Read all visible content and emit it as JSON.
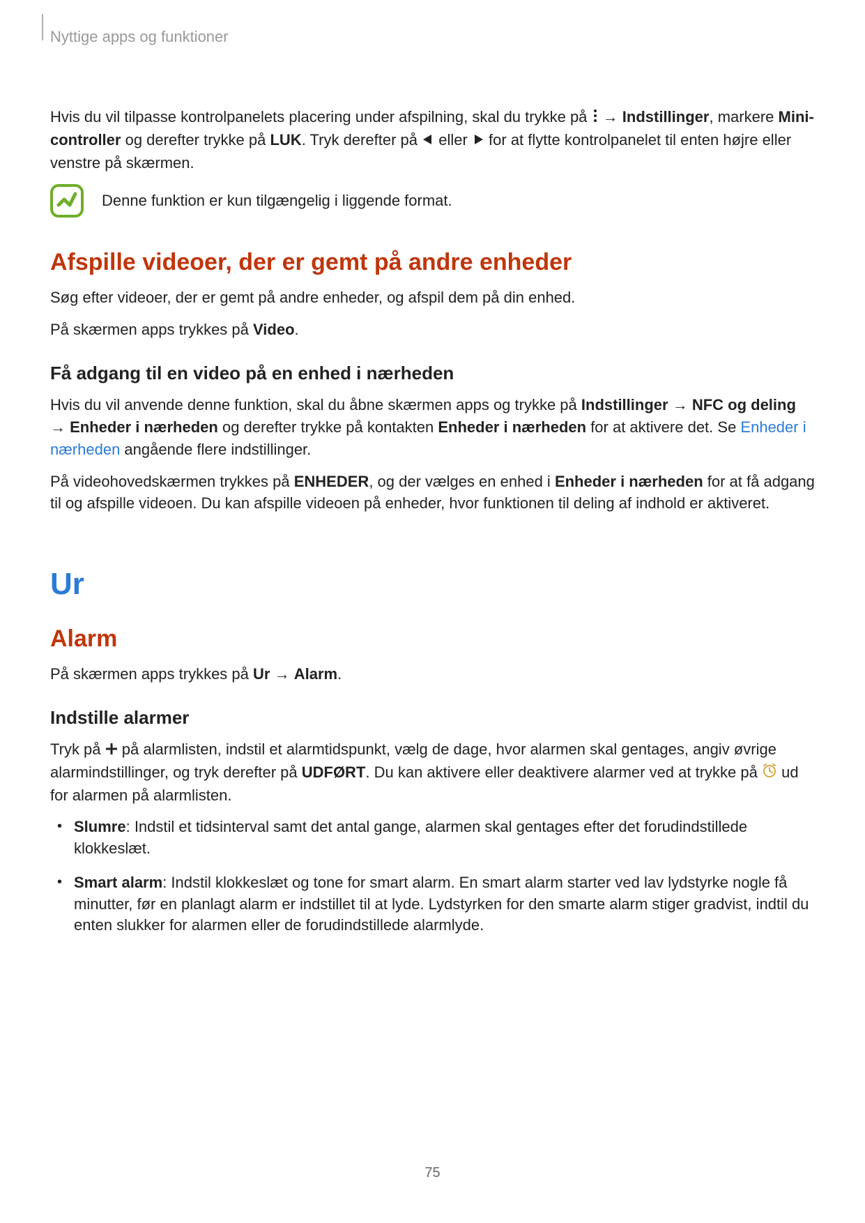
{
  "header": {
    "breadcrumb": "Nyttige apps og funktioner"
  },
  "intro": {
    "p1a": "Hvis du vil tilpasse kontrolpanelets placering under afspilning, skal du trykke på ",
    "arrow": " → ",
    "p1b": "Indstillinger",
    "p1c": ", markere ",
    "p1d": "Mini-controller",
    "p1e": " og derefter trykke på ",
    "p1f": "LUK",
    "p1g": ". Tryk derefter på ",
    "p1h": " eller ",
    "p1i": " for at flytte kontrolpanelet til enten højre eller venstre på skærmen."
  },
  "note": {
    "text": "Denne funktion er kun tilgængelig i liggende format."
  },
  "section1": {
    "heading": "Afspille videoer, der er gemt på andre enheder",
    "p1": "Søg efter videoer, der er gemt på andre enheder, og afspil dem på din enhed.",
    "p2a": "På skærmen apps trykkes på ",
    "p2b": "Video",
    "p2c": ".",
    "sub1": "Få adgang til en video på en enhed i nærheden",
    "p3a": "Hvis du vil anvende denne funktion, skal du åbne skærmen apps og trykke på ",
    "p3b": "Indstillinger",
    "p3c": " → ",
    "p3d": "NFC og deling",
    "p3e": " → ",
    "p3f": "Enheder i nærheden",
    "p3g": " og derefter trykke på kontakten ",
    "p3h": "Enheder i nærheden",
    "p3i": " for at aktivere det. Se ",
    "p3link": "Enheder i nærheden",
    "p3j": " angående flere indstillinger.",
    "p4a": "På videohovedskærmen trykkes på ",
    "p4b": "ENHEDER",
    "p4c": ", og der vælges en enhed i ",
    "p4d": "Enheder i nærheden",
    "p4e": " for at få adgang til og afspille videoen. Du kan afspille videoen på enheder, hvor funktionen til deling af indhold er aktiveret."
  },
  "section2": {
    "heading": "Ur",
    "sub": "Alarm",
    "p1a": "På skærmen apps trykkes på ",
    "p1b": "Ur",
    "p1c": " → ",
    "p1d": "Alarm",
    "p1e": ".",
    "sub2": "Indstille alarmer",
    "p2a": "Tryk på ",
    "p2b": " på alarmlisten, indstil et alarmtidspunkt, vælg de dage, hvor alarmen skal gentages, angiv øvrige alarmindstillinger, og tryk derefter på ",
    "p2c": "UDFØRT",
    "p2d": ". Du kan aktivere eller deaktivere alarmer ved at trykke på ",
    "p2e": " ud for alarmen på alarmlisten.",
    "bullets": [
      {
        "b": "Slumre",
        "rest": ": Indstil et tidsinterval samt det antal gange, alarmen skal gentages efter det forudindstillede klokkeslæt."
      },
      {
        "b": "Smart alarm",
        "rest": ": Indstil klokkeslæt og tone for smart alarm. En smart alarm starter ved lav lydstyrke nogle få minutter, før en planlagt alarm er indstillet til at lyde. Lydstyrken for den smarte alarm stiger gradvist, indtil du enten slukker for alarmen eller de forudindstillede alarmlyde."
      }
    ]
  },
  "pageNumber": "75"
}
